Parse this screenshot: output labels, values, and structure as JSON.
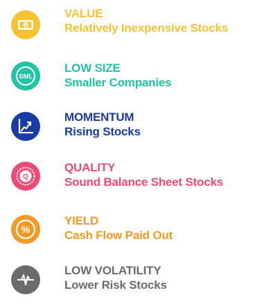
{
  "factors": [
    {
      "id": "value",
      "name": "VALUE",
      "description": "Relatively Inexpensive Stocks",
      "color": "#F7C331",
      "icon": "dollar-bill-icon"
    },
    {
      "id": "low_size",
      "name": "LOW SIZE",
      "description": "Smaller Companies",
      "color": "#1FC4A4",
      "icon": "sml-size-icon",
      "icon_text": "SML"
    },
    {
      "id": "momentum",
      "name": "MOMENTUM",
      "description": "Rising Stocks",
      "color": "#1A3AA6",
      "icon": "rising-chart-icon"
    },
    {
      "id": "quality",
      "name": "QUALITY",
      "description": "Sound Balance Sheet Stocks",
      "color": "#EE4A76",
      "icon": "quality-seal-icon",
      "icon_text": "Q"
    },
    {
      "id": "yield",
      "name": "YIELD",
      "description": "Cash Flow Paid Out",
      "color": "#F39A26",
      "icon": "percent-icon",
      "icon_text": "%"
    },
    {
      "id": "low_volatility",
      "name": "LOW VOLATILITY",
      "description": "Lower Risk Stocks",
      "color": "#6B6B6B",
      "icon": "volatility-wave-icon"
    }
  ]
}
